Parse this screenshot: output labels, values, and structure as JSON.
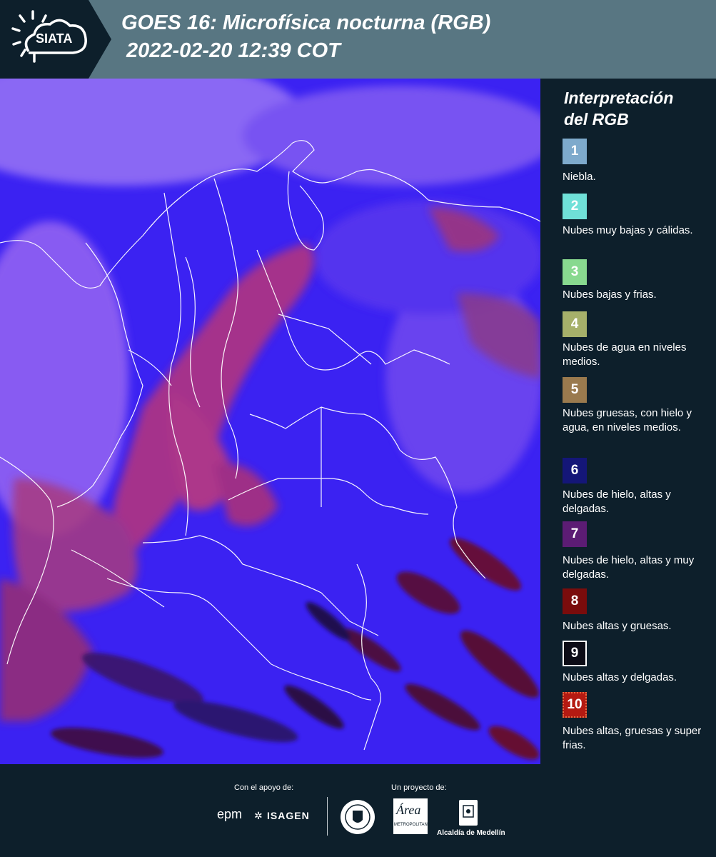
{
  "header": {
    "logo": "SIATA",
    "title_line1": "GOES 16: Microfísica nocturna (RGB)",
    "title_line2": "2022-02-20 12:39 COT"
  },
  "legend": {
    "title_line1": "Interpretación",
    "title_line2": "del RGB",
    "items": [
      {
        "number": "1",
        "color": "#7eaacc",
        "label": "Niebla."
      },
      {
        "number": "2",
        "color": "#6fe0d8",
        "label": "Nubes muy bajas y cálidas."
      },
      {
        "number": "3",
        "color": "#88d98f",
        "label": "Nubes bajas y frias."
      },
      {
        "number": "4",
        "color": "#a6b06a",
        "label": "Nubes de agua en niveles medios."
      },
      {
        "number": "5",
        "color": "#9a7a4e",
        "label": "Nubes gruesas, con hielo y agua, en niveles medios."
      },
      {
        "number": "6",
        "color": "#141678",
        "label": "Nubes de hielo, altas y delgadas."
      },
      {
        "number": "7",
        "color": "#5c1c74",
        "label": "Nubes de hielo, altas y muy delgadas."
      },
      {
        "number": "8",
        "color": "#7a0c0c",
        "label": "Nubes altas y gruesas."
      },
      {
        "number": "9",
        "color": "#0c0c16",
        "label": "Nubes altas y delgadas."
      },
      {
        "number": "10",
        "color": "#b41a12",
        "label": "Nubes altas, gruesas y super frias."
      }
    ]
  },
  "footer": {
    "support_label": "Con el apoyo de:",
    "project_label": "Un proyecto de:",
    "sponsor_1": "epm",
    "sponsor_2": "ISAGEN",
    "partner_1": "Área",
    "partner_1_sub": "METROPOLITANA",
    "partner_2": "Alcaldía de Medellín"
  }
}
